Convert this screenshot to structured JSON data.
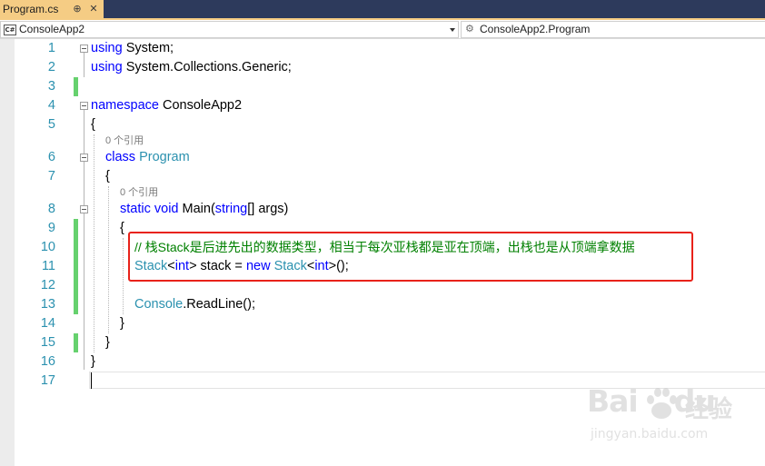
{
  "tab": {
    "title": "Program.cs",
    "pin_glyph": "⊕",
    "close_glyph": "✕"
  },
  "nav": {
    "project_icon": "C#",
    "project": "ConsoleApp2",
    "member": "ConsoleApp2.Program"
  },
  "editor": {
    "line_numbers": [
      "1",
      "2",
      "3",
      "4",
      "5",
      "6",
      "7",
      "8",
      "9",
      "10",
      "11",
      "12",
      "13",
      "14",
      "15",
      "16",
      "17"
    ],
    "code_lens_1": "0 个引用",
    "code_lens_2": "0 个引用",
    "code": {
      "l1_kw": "using",
      "l1_rest": " System;",
      "l2_kw": "using",
      "l2_rest": " System.Collections.Generic;",
      "l4_kw": "namespace",
      "l4_rest": " ConsoleApp2",
      "open_brace": "{",
      "close_brace": "}",
      "l6_kw": "class",
      "l6_type": "Program",
      "l8_kw1": "static",
      "l8_kw2": "void",
      "l8_name": " Main(",
      "l8_kw3": "string",
      "l8_rest": "[] args)",
      "l10_comment": "// 栈Stack是后进先出的数据类型，相当于每次亚栈都是亚在顶端，出栈也是从顶端拿数据",
      "l11_t1": "Stack",
      "l11_p1": "<",
      "l11_k1": "int",
      "l11_p2": "> stack = ",
      "l11_k2": "new",
      "l11_sp": " ",
      "l11_t2": "Stack",
      "l11_p3": "<",
      "l11_k3": "int",
      "l11_p4": ">();",
      "l13_type": "Console",
      "l13_rest": ".ReadLine();"
    }
  },
  "watermark": {
    "logo": "Bai",
    "logo2": "du",
    "cn": "经验",
    "url": "jingyan.baidu.com"
  },
  "colors": {
    "keyword": "#0000ff",
    "type": "#2b91af",
    "comment": "#008000",
    "highlight_border": "#e8221a",
    "change_bar": "#66d16e",
    "tab_active": "#f5cc84"
  }
}
